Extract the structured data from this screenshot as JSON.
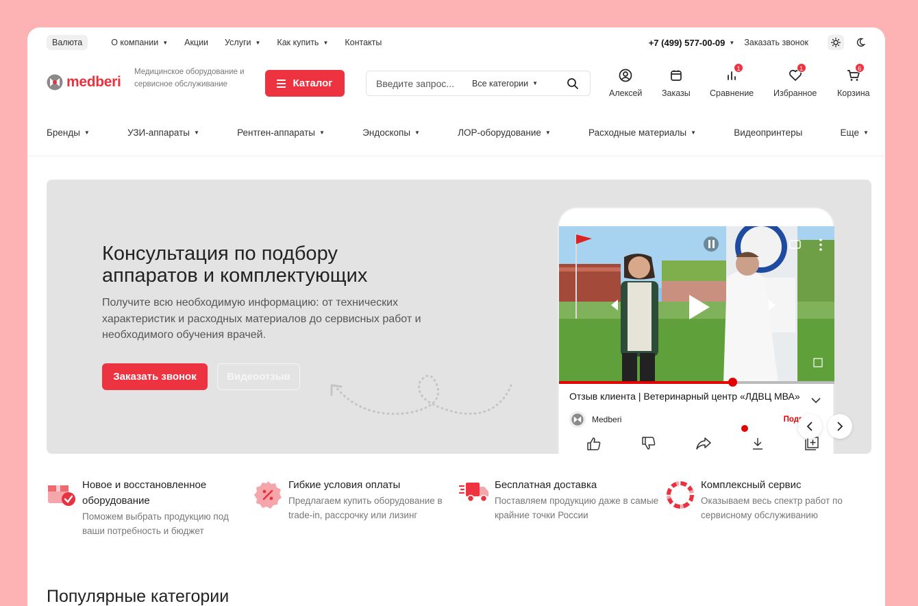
{
  "topbar": {
    "currency": "Валюта",
    "links": [
      {
        "label": "О компании",
        "dropdown": true
      },
      {
        "label": "Акции",
        "dropdown": false
      },
      {
        "label": "Услуги",
        "dropdown": true
      },
      {
        "label": "Как купить",
        "dropdown": true
      },
      {
        "label": "Контакты",
        "dropdown": false
      }
    ],
    "phone": "+7 (499) 577-00-09",
    "callback": "Заказать звонок"
  },
  "header": {
    "logo_text": "medberi",
    "tagline": "Медицинское оборудование и сервисное обслуживание",
    "catalog_label": "Каталог",
    "search_placeholder": "Введите запрос...",
    "search_category": "Все категории",
    "icons": {
      "profile": {
        "label": "Алексей",
        "icon": "user-icon"
      },
      "orders": {
        "label": "Заказы",
        "icon": "orders-icon"
      },
      "compare": {
        "label": "Сравнение",
        "icon": "compare-icon",
        "badge": "1"
      },
      "favorites": {
        "label": "Избранное",
        "icon": "heart-icon",
        "badge": "1"
      },
      "cart": {
        "label": "Корзина",
        "icon": "cart-icon",
        "badge": "6"
      }
    }
  },
  "nav": [
    "Бренды",
    "УЗИ-аппараты",
    "Рентген-аппараты",
    "Эндоскопы",
    "ЛОР-оборудование",
    "Расходные материалы",
    "Видеопринтеры",
    "Еще"
  ],
  "hero": {
    "title": "Консультация по подбору аппаратов и комплектующих",
    "text": "Получите всю необходимую информацию: от технических характеристик и расходных материалов до сервисных работ и необходимого обучения врачей.",
    "btn_call": "Заказать звонок",
    "btn_video": "Видеоотзыв",
    "video": {
      "title": "Отзыв клиента | Ветеринарный центр «ЛДВЦ МВА»",
      "channel": "Medberi",
      "subscribe": "Подпис...",
      "progress": 0.63
    }
  },
  "features": [
    {
      "title": "Новое и восстановленное оборудование",
      "desc": "Поможем выбрать продукцию под ваши потребность и бюджет",
      "icon": "box-check-icon"
    },
    {
      "title": "Гибкие условия оплаты",
      "desc": "Предлагаем купить оборудование в trade-in, рассрочку или лизинг",
      "icon": "discount-icon"
    },
    {
      "title": "Бесплатная доставка",
      "desc": "Поставляем продукцию даже в самые крайние точки России",
      "icon": "truck-icon"
    },
    {
      "title": "Комплексный сервис",
      "desc": "Оказываем весь спектр работ по сервисному обслуживанию",
      "icon": "service-ring-icon"
    }
  ],
  "popular_title": "Популярные категории",
  "colors": {
    "accent": "#ee3340",
    "background": "#fdb2b4",
    "hero_bg": "#e3e3e3"
  }
}
